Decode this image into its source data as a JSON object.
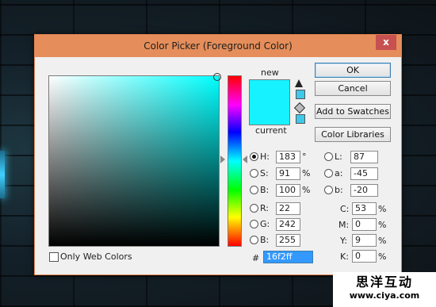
{
  "window": {
    "title": "Color Picker (Foreground Color)",
    "close_glyph": "x"
  },
  "swatches": {
    "new_label": "new",
    "current_label": "current",
    "new_color": "#16f2ff"
  },
  "buttons": {
    "ok": "OK",
    "cancel": "Cancel",
    "add_to_swatches": "Add to Swatches",
    "color_libraries": "Color Libraries"
  },
  "hsb": {
    "h_label": "H:",
    "h_value": "183",
    "h_unit": "°",
    "s_label": "S:",
    "s_value": "91",
    "s_unit": "%",
    "b_label": "B:",
    "b_value": "100",
    "b_unit": "%"
  },
  "rgb": {
    "r_label": "R:",
    "r_value": "22",
    "g_label": "G:",
    "g_value": "242",
    "b_label": "B:",
    "b_value": "255"
  },
  "lab": {
    "l_label": "L:",
    "l_value": "87",
    "a_label": "a:",
    "a_value": "-45",
    "b_label": "b:",
    "b_value": "-20"
  },
  "cmyk": {
    "c_label": "C:",
    "c_value": "53",
    "c_unit": "%",
    "m_label": "M:",
    "m_value": "0",
    "m_unit": "%",
    "y_label": "Y:",
    "y_value": "9",
    "y_unit": "%",
    "k_label": "K:",
    "k_value": "0",
    "k_unit": "%"
  },
  "hex": {
    "label": "#",
    "value": "16f2ff"
  },
  "web_colors": {
    "label": "Only Web Colors"
  },
  "watermark": {
    "line1": "思洋互动",
    "line2": "www.ciya.com"
  },
  "icons": [
    "close-icon",
    "gamut-warning-icon",
    "web-safe-cube-icon"
  ]
}
